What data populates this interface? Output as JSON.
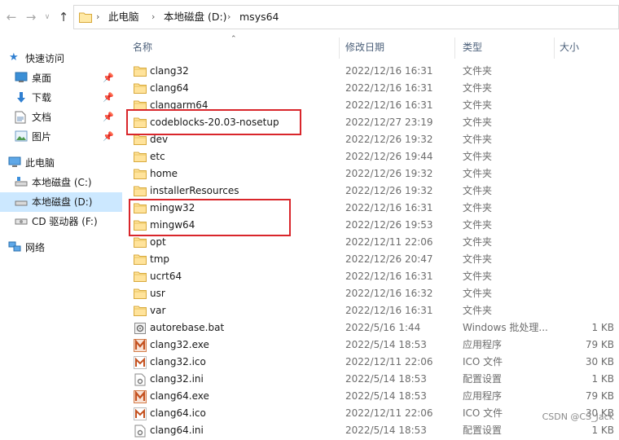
{
  "nav": {
    "back_icon": "arrow-left-icon",
    "forward_icon": "arrow-right-icon",
    "up_icon": "arrow-up-icon"
  },
  "breadcrumb": [
    "此电脑",
    "本地磁盘 (D:)",
    "msys64"
  ],
  "sidebar": {
    "quick_access": "快速访问",
    "pinned": [
      {
        "label": "桌面",
        "icon": "desktop-icon"
      },
      {
        "label": "下载",
        "icon": "download-icon"
      },
      {
        "label": "文档",
        "icon": "documents-icon"
      },
      {
        "label": "图片",
        "icon": "pictures-icon"
      }
    ],
    "this_pc": "此电脑",
    "drives": [
      {
        "label": "本地磁盘 (C:)",
        "selected": false
      },
      {
        "label": "本地磁盘 (D:)",
        "selected": true
      },
      {
        "label": "CD 驱动器 (F:)",
        "selected": false
      }
    ],
    "network": "网络"
  },
  "columns": {
    "name": "名称",
    "modified": "修改日期",
    "type": "类型",
    "size": "大小"
  },
  "files": [
    {
      "name": "clang32",
      "modified": "2022/12/16 16:31",
      "type": "文件夹",
      "size": "",
      "icon": "folder"
    },
    {
      "name": "clang64",
      "modified": "2022/12/16 16:31",
      "type": "文件夹",
      "size": "",
      "icon": "folder"
    },
    {
      "name": "clangarm64",
      "modified": "2022/12/16 16:31",
      "type": "文件夹",
      "size": "",
      "icon": "folder"
    },
    {
      "name": "codeblocks-20.03-nosetup",
      "modified": "2022/12/27 23:19",
      "type": "文件夹",
      "size": "",
      "icon": "folder"
    },
    {
      "name": "dev",
      "modified": "2022/12/26 19:32",
      "type": "文件夹",
      "size": "",
      "icon": "folder"
    },
    {
      "name": "etc",
      "modified": "2022/12/26 19:44",
      "type": "文件夹",
      "size": "",
      "icon": "folder"
    },
    {
      "name": "home",
      "modified": "2022/12/26 19:32",
      "type": "文件夹",
      "size": "",
      "icon": "folder"
    },
    {
      "name": "installerResources",
      "modified": "2022/12/26 19:32",
      "type": "文件夹",
      "size": "",
      "icon": "folder"
    },
    {
      "name": "mingw32",
      "modified": "2022/12/16 16:31",
      "type": "文件夹",
      "size": "",
      "icon": "folder"
    },
    {
      "name": "mingw64",
      "modified": "2022/12/26 19:53",
      "type": "文件夹",
      "size": "",
      "icon": "folder"
    },
    {
      "name": "opt",
      "modified": "2022/12/11 22:06",
      "type": "文件夹",
      "size": "",
      "icon": "folder"
    },
    {
      "name": "tmp",
      "modified": "2022/12/26 20:47",
      "type": "文件夹",
      "size": "",
      "icon": "folder"
    },
    {
      "name": "ucrt64",
      "modified": "2022/12/16 16:31",
      "type": "文件夹",
      "size": "",
      "icon": "folder"
    },
    {
      "name": "usr",
      "modified": "2022/12/16 16:32",
      "type": "文件夹",
      "size": "",
      "icon": "folder"
    },
    {
      "name": "var",
      "modified": "2022/12/16 16:31",
      "type": "文件夹",
      "size": "",
      "icon": "folder"
    },
    {
      "name": "autorebase.bat",
      "modified": "2022/5/16 1:44",
      "type": "Windows 批处理...",
      "size": "1 KB",
      "icon": "bat"
    },
    {
      "name": "clang32.exe",
      "modified": "2022/5/14 18:53",
      "type": "应用程序",
      "size": "79 KB",
      "icon": "exe"
    },
    {
      "name": "clang32.ico",
      "modified": "2022/12/11 22:06",
      "type": "ICO 文件",
      "size": "30 KB",
      "icon": "ico"
    },
    {
      "name": "clang32.ini",
      "modified": "2022/5/14 18:53",
      "type": "配置设置",
      "size": "1 KB",
      "icon": "ini"
    },
    {
      "name": "clang64.exe",
      "modified": "2022/5/14 18:53",
      "type": "应用程序",
      "size": "79 KB",
      "icon": "exe"
    },
    {
      "name": "clang64.ico",
      "modified": "2022/12/11 22:06",
      "type": "ICO 文件",
      "size": "30 KB",
      "icon": "ico"
    },
    {
      "name": "clang64.ini",
      "modified": "2022/5/14 18:53",
      "type": "配置设置",
      "size": "1 KB",
      "icon": "ini"
    }
  ],
  "highlight_color": "#d9262b",
  "watermark": "CSDN @CS_Jack"
}
